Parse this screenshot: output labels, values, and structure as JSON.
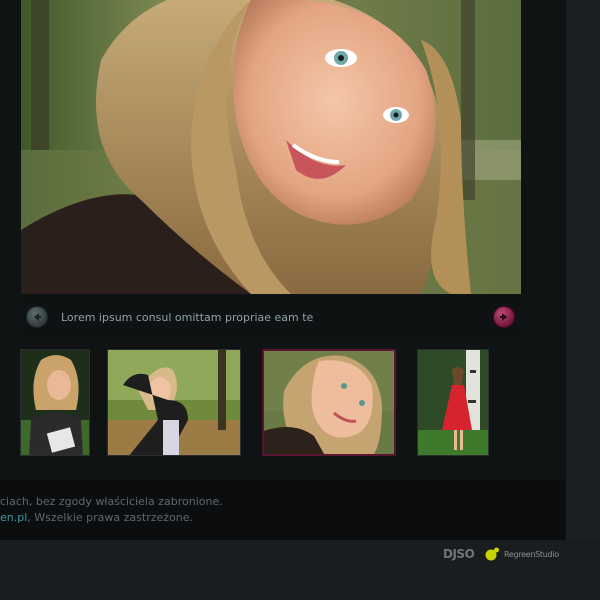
{
  "gallery": {
    "hero": {
      "alt": "",
      "caption": "Lorem ipsum consul omittam propriae eam te"
    },
    "nav": {
      "prev_icon": "arrow-left-icon",
      "next_icon": "arrow-right-icon"
    },
    "thumbnails": [
      {
        "active": false
      },
      {
        "active": false
      },
      {
        "active": true
      },
      {
        "active": false
      }
    ]
  },
  "footer": {
    "line1": "ciach, bez zgody właściciela zabronione.",
    "line2_link": "en.pl",
    "line2_text": ", Wszelkie prawa zastrzeżone."
  },
  "credits": {
    "djso": "DJSO",
    "regreen": "RegreenStudio"
  },
  "colors": {
    "accent": "#6d1237",
    "link": "#3d9aa3",
    "panel": "#101314",
    "background": "#1a1d1f",
    "regreen_logo": "#c8d400"
  }
}
